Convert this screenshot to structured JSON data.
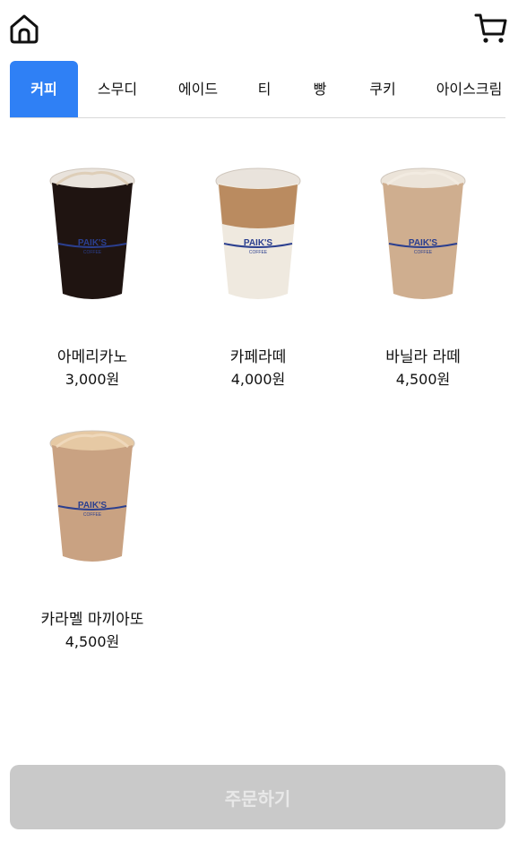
{
  "header": {
    "home_icon": "home-icon",
    "cart_icon": "cart-icon"
  },
  "tabs": [
    {
      "label": "커피",
      "active": true
    },
    {
      "label": "스무디",
      "active": false
    },
    {
      "label": "에이드",
      "active": false
    },
    {
      "label": "티",
      "active": false
    },
    {
      "label": "빵",
      "active": false
    },
    {
      "label": "쿠키",
      "active": false
    },
    {
      "label": "아이스크림",
      "active": false
    }
  ],
  "products": [
    {
      "name": "아메리카노",
      "price": "3,000원",
      "cup_brand": "PAIK'S",
      "cup_sub": "COFFEE",
      "drink_color": "#1f1411"
    },
    {
      "name": "카페라떼",
      "price": "4,000원",
      "cup_brand": "PAIK'S",
      "cup_sub": "COFFEE",
      "drink_color": "#efe9df"
    },
    {
      "name": "바닐라 라떼",
      "price": "4,500원",
      "cup_brand": "PAIK'S",
      "cup_sub": "COFFEE",
      "drink_color": "#cfae8f"
    },
    {
      "name": "카라멜 마끼아또",
      "price": "4,500원",
      "cup_brand": "PAIK'S",
      "cup_sub": "COFFEE",
      "drink_color": "#c9a282"
    }
  ],
  "footer": {
    "order_label": "주문하기"
  },
  "colors": {
    "accent": "#2f80f5",
    "disabled_button": "#c9c9c9",
    "cup_band": "#2b3f8f"
  }
}
